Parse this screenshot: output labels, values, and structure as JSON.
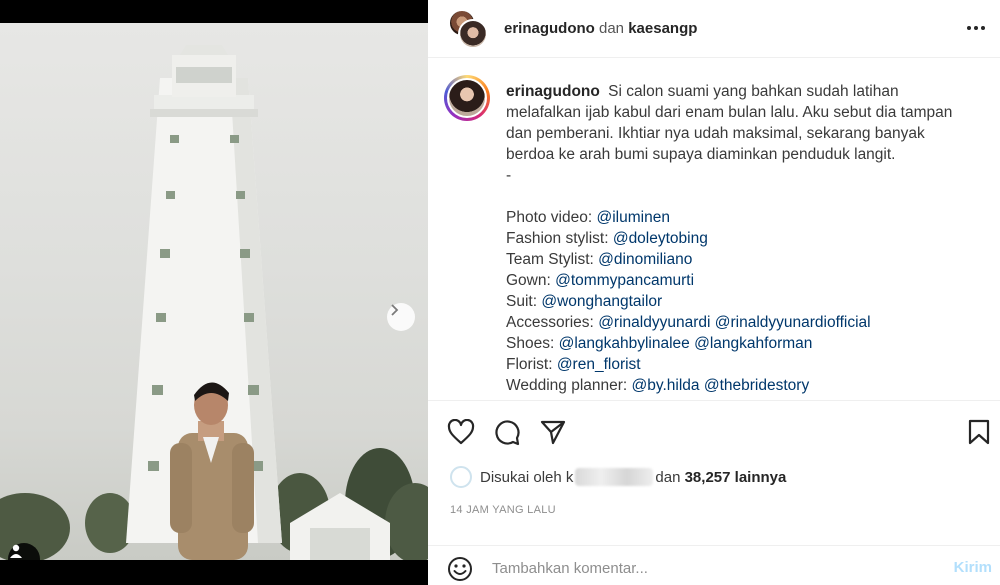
{
  "post": {
    "header": {
      "username": "erinagudono",
      "joiner": "dan",
      "collaborator": "kaesangp"
    },
    "caption": {
      "username": "erinagudono",
      "text": "Si calon suami yang bahkan sudah latihan melafalkan ijab kabul dari enam bulan lalu. Aku sebut dia tampan dan pemberani. Ikhtiar nya udah maksimal, sekarang banyak berdoa ke arah bumi supaya diaminkan penduduk langit.",
      "dash": "-",
      "credits": [
        {
          "label": "Photo video:",
          "links": [
            "@iluminen"
          ]
        },
        {
          "label": "Fashion stylist:",
          "links": [
            "@doleytobing"
          ]
        },
        {
          "label": "Team Stylist:",
          "links": [
            "@dinomiliano"
          ]
        },
        {
          "label": "Gown:",
          "links": [
            "@tommypancamurti"
          ]
        },
        {
          "label": "Suit:",
          "links": [
            "@wonghangtailor"
          ]
        },
        {
          "label": "Accessories:",
          "links": [
            "@rinaldyyunardi",
            "@rinaldyyunardiofficial"
          ]
        },
        {
          "label": "Shoes:",
          "links": [
            "@langkahbylinalee",
            "@langkahforman"
          ]
        },
        {
          "label": "Florist:",
          "links": [
            "@ren_florist"
          ]
        },
        {
          "label": "Wedding planner:",
          "links": [
            "@by.hilda",
            "@thebridestory"
          ]
        }
      ]
    },
    "likes": {
      "prefix": "Disukai oleh",
      "visible_letter": "k",
      "joiner": "dan",
      "count": "38,257",
      "suffix": "lainnya"
    },
    "timestamp": "14 JAM YANG LALU",
    "comment": {
      "placeholder": "Tambahkan komentar...",
      "send_label": "Kirim"
    },
    "carousel": {
      "slides": 2,
      "active": 0
    }
  },
  "icons": {
    "more": "more-horizontal-icon",
    "like": "heart-icon",
    "comment": "comment-icon",
    "share": "send-icon",
    "save": "bookmark-icon",
    "emoji": "emoji-icon",
    "next": "chevron-right-icon",
    "tags": "user-tag-icon"
  },
  "colors": {
    "link": "#00376b",
    "muted": "#8e8e8e",
    "send_disabled": "#b2dffc"
  }
}
